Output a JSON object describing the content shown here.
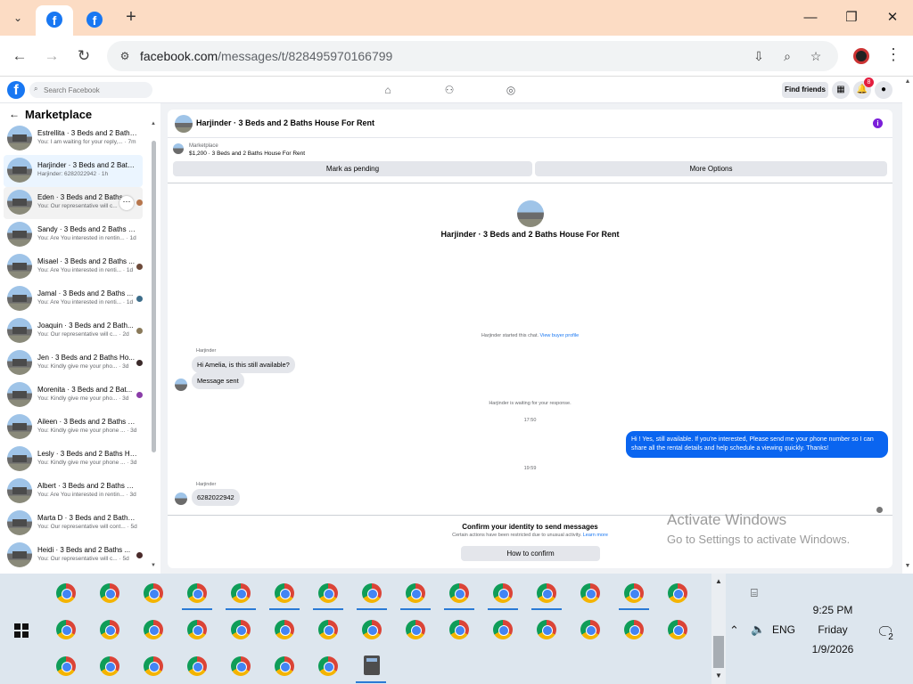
{
  "browser": {
    "tab_menu": "⌄",
    "new_tab": "+",
    "url_host": "facebook.com",
    "url_path": "/messages/t/828495970166799",
    "controls": {
      "minimize": "—",
      "restore": "❐",
      "close": "✕"
    }
  },
  "fb": {
    "logo": "f",
    "search_placeholder": "Search Facebook",
    "find_friends": "Find friends",
    "notifications_count": "8"
  },
  "sidebar": {
    "back": "←",
    "title": "Marketplace",
    "conversations": [
      {
        "title": "Estrellita · 3 Beds and 2 Baths ...",
        "sub": "You: I am waiting for your reply,... · 7m"
      },
      {
        "title": "Harjinder · 3 Beds and 2 Baths...",
        "sub": "Harjinder: 6282022942 · 1h"
      },
      {
        "title": "Eden · 3 Beds and 2 Baths ...",
        "sub": "You: Our representative will c..."
      },
      {
        "title": "Sandy · 3 Beds and 2 Baths H...",
        "sub": "You: Are You interested in rentin... · 1d"
      },
      {
        "title": "Misael · 3 Beds and 2 Baths ...",
        "sub": "You: Are You interested in renti... · 1d"
      },
      {
        "title": "Jamal · 3 Beds and 2 Baths ...",
        "sub": "You: Are You interested in renti... · 1d"
      },
      {
        "title": "Joaquin · 3 Beds and 2 Bath...",
        "sub": "You: Our representative will c... · 2d"
      },
      {
        "title": "Jen · 3 Beds and 2 Baths Ho...",
        "sub": "You: Kindly give me your pho... · 3d"
      },
      {
        "title": "Morenita · 3 Beds and 2 Bat...",
        "sub": "You: Kindly give me your pho... · 3d"
      },
      {
        "title": "Aileen · 3 Beds and 2 Baths H...",
        "sub": "You: Kindly give me your phone ... · 3d"
      },
      {
        "title": "Lesly · 3 Beds and 2 Baths Ho...",
        "sub": "You: Kindly give me your phone ... · 3d"
      },
      {
        "title": "Albert · 3 Beds and 2 Baths H...",
        "sub": "You: Are You interested in rentin... · 3d"
      },
      {
        "title": "Marta D · 3 Beds and 2 Baths ...",
        "sub": "You: Our representative will cont... · 5d"
      },
      {
        "title": "Heidi · 3 Beds and 2 Baths ...",
        "sub": "You: Our representative will c... · 5d"
      }
    ]
  },
  "chat": {
    "header_title": "Harjinder · 3 Beds and 2 Baths House For Rent",
    "info": "i",
    "listing_label": "Marketplace",
    "listing_detail": "$1,200 · 3 Beds and 2 Baths House For Rent",
    "mark_pending": "Mark as pending",
    "more_options": "More Options",
    "big_title": "Harjinder · 3 Beds and 2 Baths House For Rent",
    "started_text": "Harjinder started this chat.",
    "view_buyer": "View buyer profile",
    "sender1": "Harjinder",
    "msg1": "Hi Amelia, is this still available?",
    "msg2": "Message sent",
    "waiting": "Harjinder is waiting for your response.",
    "time1": "17:50",
    "outgoing": "Hi ! Yes, still available. If you're interested, Please send me your phone number so I can share all the rental details and help schedule a viewing quickly. Thanks!",
    "time2": "19:59",
    "sender2": "Harjinder",
    "msg3": "6282022942",
    "confirm_title": "Confirm your identity to send messages",
    "confirm_desc": "Certain actions have been restricted due to unusual activity.",
    "learn_more": "Learn more",
    "how_to_confirm": "How to confirm"
  },
  "watermark": {
    "line1": "Activate Windows",
    "line2": "Go to Settings to activate Windows."
  },
  "taskbar": {
    "lang": "ENG",
    "time": "9:25 PM",
    "day": "Friday",
    "date": "1/9/2026",
    "notif_count": "2"
  }
}
